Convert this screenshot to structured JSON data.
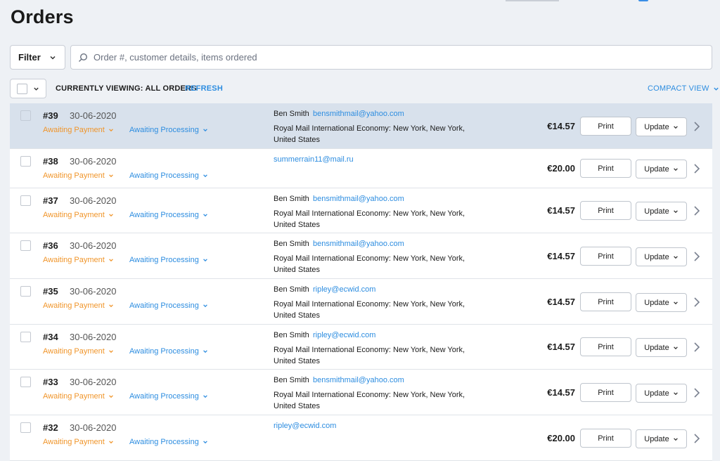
{
  "header": {
    "title": "Orders"
  },
  "toolbar": {
    "filter_label": "Filter",
    "search_placeholder": "Order #, customer details, items ordered",
    "viewing_label": "CURRENTLY VIEWING: ALL ORDERS",
    "refresh_label": "REFRESH",
    "compact_view_label": "COMPACT VIEW"
  },
  "actions": {
    "print_label": "Print",
    "update_label": "Update"
  },
  "colors": {
    "accent": "#2d8de0",
    "awaiting_payment": "#f0952a",
    "selected_row": "#d8e1ec"
  },
  "orders": [
    {
      "number": "#39",
      "date": "30-06-2020",
      "payment_status": "Awaiting Payment",
      "fulfillment_status": "Awaiting Processing",
      "customer": "Ben Smith",
      "email": "bensmithmail@yahoo.com",
      "shipping": "Royal Mail International Economy: New York, New York, United States",
      "total": "€14.57",
      "selected": true
    },
    {
      "number": "#38",
      "date": "30-06-2020",
      "payment_status": "Awaiting Payment",
      "fulfillment_status": "Awaiting Processing",
      "customer": "",
      "email": "summerrain11@mail.ru",
      "shipping": "",
      "total": "€20.00"
    },
    {
      "number": "#37",
      "date": "30-06-2020",
      "payment_status": "Awaiting Payment",
      "fulfillment_status": "Awaiting Processing",
      "customer": "Ben Smith",
      "email": "bensmithmail@yahoo.com",
      "shipping": "Royal Mail International Economy: New York, New York, United States",
      "total": "€14.57"
    },
    {
      "number": "#36",
      "date": "30-06-2020",
      "payment_status": "Awaiting Payment",
      "fulfillment_status": "Awaiting Processing",
      "customer": "Ben Smith",
      "email": "bensmithmail@yahoo.com",
      "shipping": "Royal Mail International Economy: New York, New York, United States",
      "total": "€14.57"
    },
    {
      "number": "#35",
      "date": "30-06-2020",
      "payment_status": "Awaiting Payment",
      "fulfillment_status": "Awaiting Processing",
      "customer": "Ben Smith",
      "email": "ripley@ecwid.com",
      "shipping": "Royal Mail International Economy: New York, New York, United States",
      "total": "€14.57"
    },
    {
      "number": "#34",
      "date": "30-06-2020",
      "payment_status": "Awaiting Payment",
      "fulfillment_status": "Awaiting Processing",
      "customer": "Ben Smith",
      "email": "ripley@ecwid.com",
      "shipping": "Royal Mail International Economy: New York, New York, United States",
      "total": "€14.57"
    },
    {
      "number": "#33",
      "date": "30-06-2020",
      "payment_status": "Awaiting Payment",
      "fulfillment_status": "Awaiting Processing",
      "customer": "Ben Smith",
      "email": "bensmithmail@yahoo.com",
      "shipping": "Royal Mail International Economy: New York, New York, United States",
      "total": "€14.57"
    },
    {
      "number": "#32",
      "date": "30-06-2020",
      "payment_status": "Awaiting Payment",
      "fulfillment_status": "Awaiting Processing",
      "customer": "",
      "email": "ripley@ecwid.com",
      "shipping": "",
      "total": "€20.00"
    }
  ]
}
